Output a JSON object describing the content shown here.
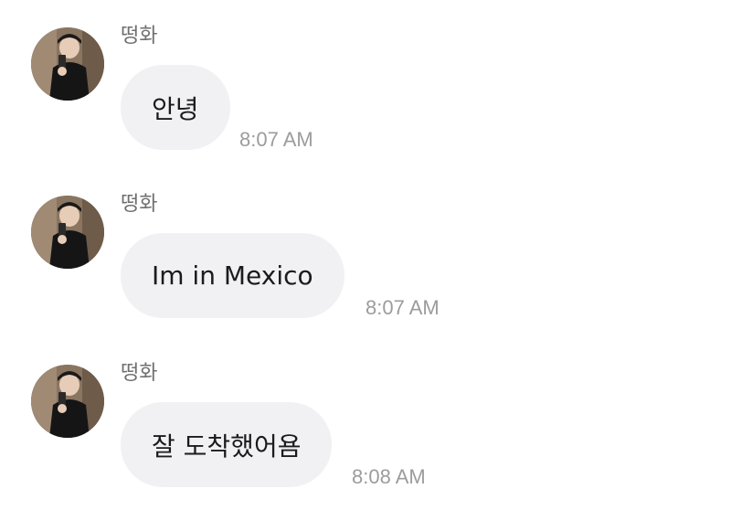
{
  "messages": [
    {
      "sender": "떵화",
      "text": "안녕",
      "time": "8:07 AM"
    },
    {
      "sender": "떵화",
      "text": "Im in Mexico",
      "time": "8:07 AM"
    },
    {
      "sender": "떵화",
      "text": "잘 도착했어욤",
      "time": "8:08 AM"
    }
  ],
  "colors": {
    "bubble": "#f1f1f4",
    "sender_text": "#6f6f6f",
    "time_text": "#9c9c9c",
    "message_text": "#1b1b1b"
  }
}
